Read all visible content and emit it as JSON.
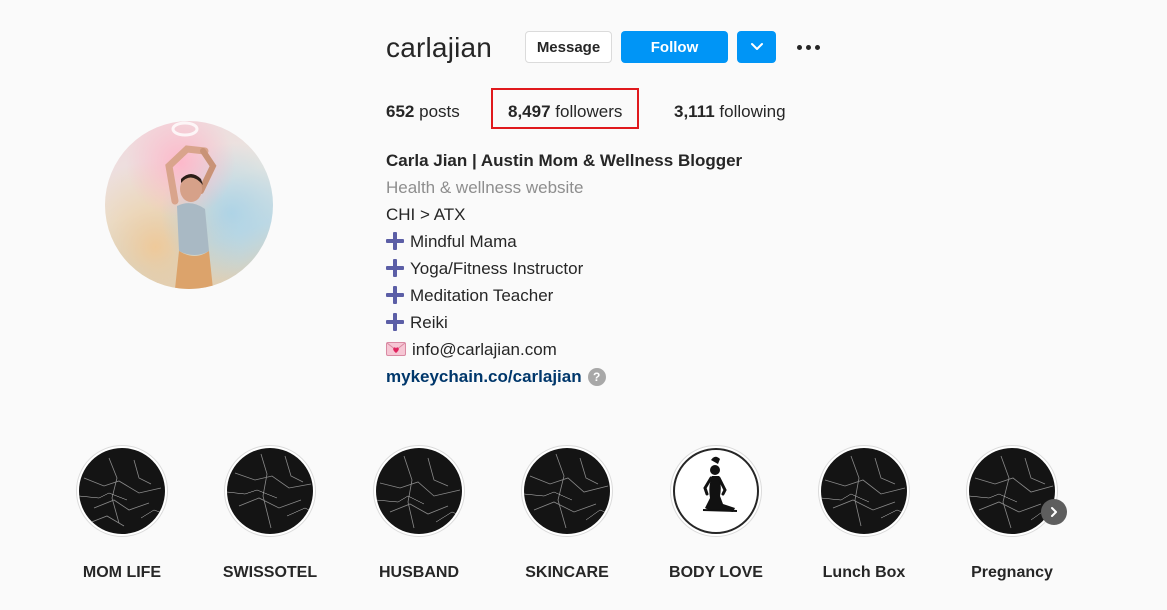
{
  "profile": {
    "username": "carlajian",
    "buttons": {
      "message": "Message",
      "follow": "Follow"
    },
    "stats": {
      "posts_count": "652",
      "posts_label": "posts",
      "followers_count": "8,497",
      "followers_label": "followers",
      "following_count": "3,111",
      "following_label": "following"
    },
    "bio": {
      "name": "Carla Jian | Austin Mom & Wellness Blogger",
      "category": "Health & wellness website",
      "lines": [
        "CHI > ATX",
        "Mindful Mama",
        "Yoga/Fitness Instructor",
        "Meditation Teacher",
        "Reiki",
        "info@carlajian.com"
      ],
      "link": "mykeychain.co/carlajian",
      "info_icon": "?"
    }
  },
  "highlights": [
    {
      "label": "MOM LIFE",
      "cover": "black-marble"
    },
    {
      "label": "SWISSOTEL",
      "cover": "black-marble"
    },
    {
      "label": "HUSBAND",
      "cover": "black-marble"
    },
    {
      "label": "SKINCARE",
      "cover": "black-marble"
    },
    {
      "label": "BODY LOVE",
      "cover": "yoga-silhouette"
    },
    {
      "label": "Lunch Box",
      "cover": "black-marble"
    },
    {
      "label": "Pregnancy",
      "cover": "black-marble"
    }
  ],
  "colors": {
    "background": "#fafafa",
    "follow_blue": "#0095f6",
    "link_blue": "#00376b",
    "highlight_box_red": "#e0191d",
    "plus_purple": "#5b5ea6"
  },
  "icons": [
    "chevron-down-icon",
    "more-options-icon",
    "plus-icon",
    "love-letter-icon",
    "info-icon",
    "chevron-right-icon"
  ]
}
